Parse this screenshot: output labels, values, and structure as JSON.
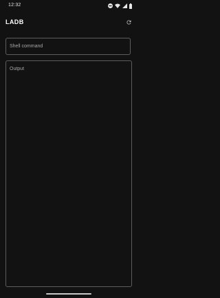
{
  "status_bar": {
    "time": "12:32",
    "icons": [
      "dnd-icon",
      "wifi-icon",
      "signal-icon",
      "battery-icon"
    ]
  },
  "app_bar": {
    "title": "LADB",
    "refresh_icon": "refresh-icon"
  },
  "shell": {
    "placeholder": "Shell command",
    "value": ""
  },
  "output": {
    "label": "Output",
    "text": ""
  },
  "colors": {
    "background": "#121212",
    "border": "#5e5e5e",
    "hint_text": "#a8a8a8",
    "title_text": "#ffffff"
  }
}
